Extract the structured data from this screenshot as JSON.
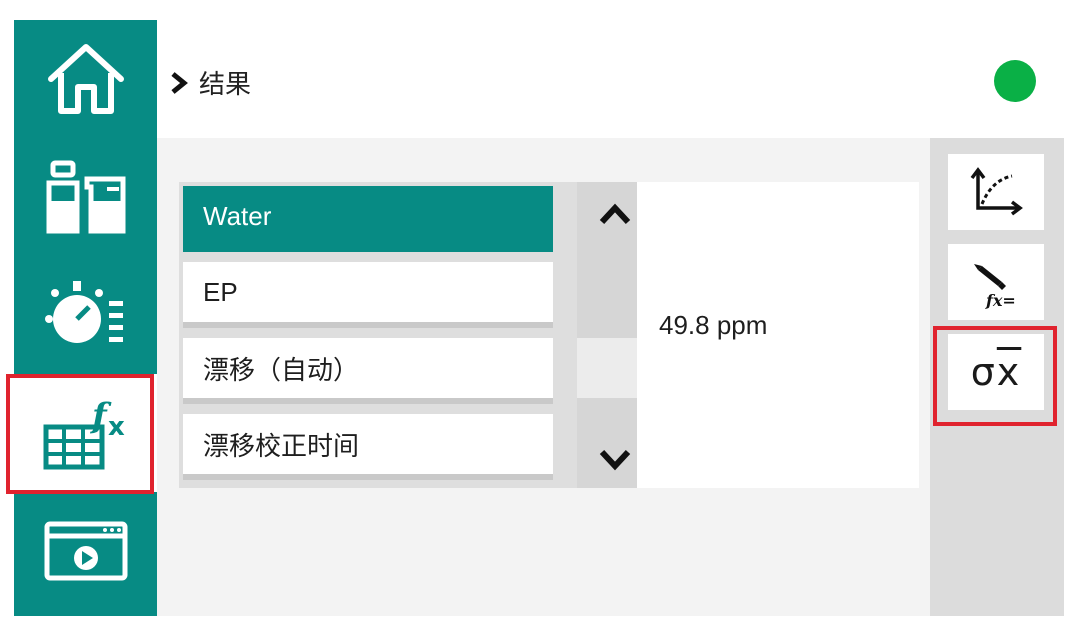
{
  "breadcrumb": {
    "chevron": "›",
    "title": "结果"
  },
  "status": {
    "color": "#0ab046",
    "icon": "status-dot"
  },
  "sidebar": {
    "items": [
      {
        "name": "home",
        "icon": "home-icon",
        "active": false
      },
      {
        "name": "samples",
        "icon": "bottles-beaker-icon",
        "active": false
      },
      {
        "name": "method",
        "icon": "stopwatch-icon",
        "active": false
      },
      {
        "name": "results",
        "icon": "table-fx-icon",
        "active": true
      },
      {
        "name": "media",
        "icon": "video-window-icon",
        "active": false
      }
    ]
  },
  "results_list": {
    "items": [
      {
        "label": "Water",
        "selected": true
      },
      {
        "label": "EP",
        "selected": false
      },
      {
        "label": "漂移（自动）",
        "selected": false
      },
      {
        "label": "漂移校正时间",
        "selected": false
      }
    ]
  },
  "value": {
    "text": "49.8 ppm"
  },
  "tools": {
    "curve": {
      "icon": "curve-chart-icon"
    },
    "formula": {
      "icon": "pen-fx-icon",
      "label": "fx="
    },
    "statistics": {
      "icon": "sigma-xbar-icon",
      "sigma": "σ",
      "xbar": "x"
    }
  },
  "colors": {
    "accent": "#078b84",
    "highlight": "#e0232e",
    "status_ok": "#0ab046"
  }
}
